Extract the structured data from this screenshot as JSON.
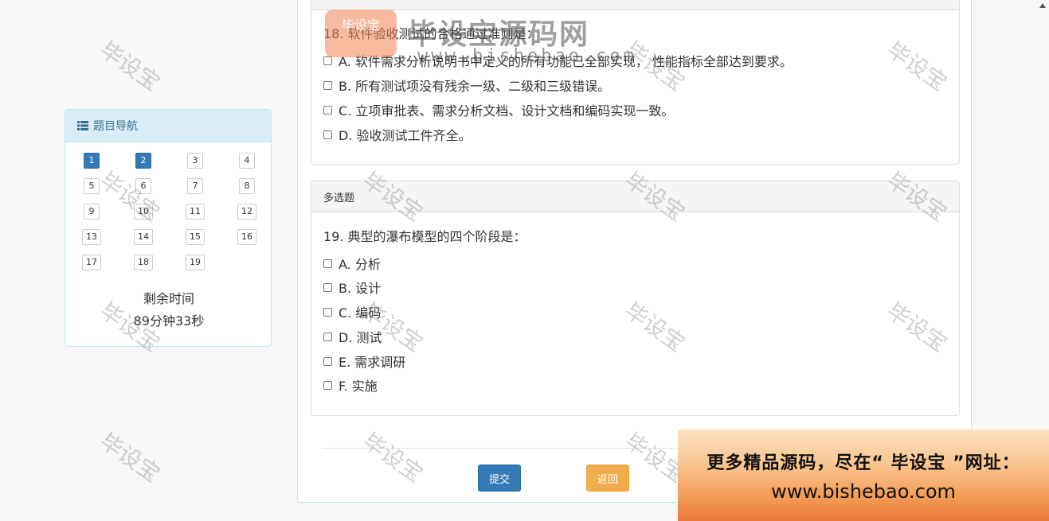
{
  "nav": {
    "title": "题目导航",
    "items": [
      {
        "num": "1",
        "active": true
      },
      {
        "num": "2",
        "active": true
      },
      {
        "num": "3",
        "active": false
      },
      {
        "num": "4",
        "active": false
      },
      {
        "num": "5",
        "active": false
      },
      {
        "num": "6",
        "active": false
      },
      {
        "num": "7",
        "active": false
      },
      {
        "num": "8",
        "active": false
      },
      {
        "num": "9",
        "active": false
      },
      {
        "num": "10",
        "active": false
      },
      {
        "num": "11",
        "active": false
      },
      {
        "num": "12",
        "active": false
      },
      {
        "num": "13",
        "active": false
      },
      {
        "num": "14",
        "active": false
      },
      {
        "num": "15",
        "active": false
      },
      {
        "num": "16",
        "active": false
      },
      {
        "num": "17",
        "active": false
      },
      {
        "num": "18",
        "active": false
      },
      {
        "num": "19",
        "active": false
      }
    ],
    "timer_label": "剩余时间",
    "timer_value": "89分钟33秒"
  },
  "q18": {
    "question": "18. 软件验收测试的合格通过准则是：",
    "options": [
      "A. 软件需求分析说明书中定义的所有功能已全部实现， 性能指标全部达到要求。",
      "B. 所有测试项没有残余一级、二级和三级错误。",
      "C. 立项审批表、需求分析文档、设计文档和编码实现一致。",
      "D. 验收测试工件齐全。"
    ]
  },
  "q19": {
    "heading": "多选题",
    "question": "19. 典型的瀑布模型的四个阶段是：",
    "options": [
      "A. 分析",
      "B. 设计",
      "C. 编码",
      "D. 测试",
      "E. 需求调研",
      "F. 实施"
    ]
  },
  "buttons": {
    "submit": "提交",
    "back": "返回"
  },
  "watermark": {
    "text": "毕设宝",
    "logo_badge": "毕设宝",
    "logo_title": "毕设宝源码网",
    "logo_url": "www.bishebao.com"
  },
  "promo": {
    "line1": "更多精品源码，尽在“ 毕设宝 ”网址：",
    "line2": "www.bishebao.com"
  },
  "colors": {
    "primary": "#337ab7",
    "warning": "#f0ad4e",
    "info_bg": "#d9edf7",
    "info_border": "#bce8f1"
  }
}
